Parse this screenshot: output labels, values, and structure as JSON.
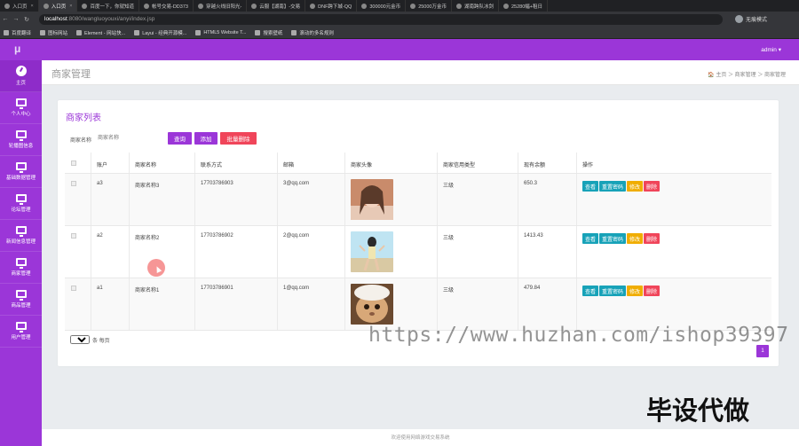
{
  "browser": {
    "tabs": [
      {
        "label": "入口页",
        "active": false
      },
      {
        "label": "入口页",
        "active": true
      },
      {
        "label": "百度一下，你就知道",
        "active": false
      },
      {
        "label": "帐号交易-DD373",
        "active": false
      },
      {
        "label": "穿越火线旧阳光-",
        "active": false
      },
      {
        "label": "云服【湖南】-交易",
        "active": false
      },
      {
        "label": "DNF跨下城-QQ",
        "active": false
      },
      {
        "label": "300000元金币",
        "active": false
      },
      {
        "label": "25000万金币",
        "active": false
      },
      {
        "label": "湖南跨队冰剑",
        "active": false
      },
      {
        "label": "25280幅+租日",
        "active": false
      }
    ],
    "url_host": "localhost",
    "url_path": ":8080/wangluoyouxi/anyi/index.jsp",
    "profile_label": "无痕模式",
    "bookmarks": [
      "百度翻译",
      "图标网站",
      "Element - 网站快...",
      "Layui - 经典开源模...",
      "HTML5 Website T...",
      "搜索壁纸",
      "滚动的多名规则"
    ]
  },
  "app": {
    "logo": "μ",
    "user": "admin ▾",
    "sidebar": [
      {
        "label": "主页",
        "icon": "dashboard-icon"
      },
      {
        "label": "个人中心",
        "icon": "monitor-icon"
      },
      {
        "label": "轮播图信息",
        "icon": "monitor-icon"
      },
      {
        "label": "基础数据管理",
        "icon": "monitor-icon"
      },
      {
        "label": "论坛管理",
        "icon": "monitor-icon"
      },
      {
        "label": "新闻信息管理",
        "icon": "monitor-icon"
      },
      {
        "label": "商家管理",
        "icon": "monitor-icon"
      },
      {
        "label": "商品管理",
        "icon": "monitor-icon"
      },
      {
        "label": "用户管理",
        "icon": "monitor-icon"
      }
    ],
    "page_title": "商家管理",
    "breadcrumb": "🏠 主页 ＞ 商家管理 ＞ 商家管理"
  },
  "list": {
    "title": "商家列表",
    "search_label": "商家名称",
    "search_placeholder": "商家名称",
    "buttons": {
      "query": "查询",
      "add": "添加",
      "batch_delete": "批量删除"
    },
    "columns": [
      "",
      "账户",
      "商家名称",
      "联系方式",
      "邮箱",
      "商家头像",
      "商家信用类型",
      "现有余额",
      "操作"
    ],
    "rows": [
      {
        "account": "a3",
        "name": "商家名称3",
        "phone": "17703786903",
        "email": "3@qq.com",
        "credit": "三级",
        "balance": "650.3"
      },
      {
        "account": "a2",
        "name": "商家名称2",
        "phone": "17703786902",
        "email": "2@qq.com",
        "credit": "三级",
        "balance": "1413.43"
      },
      {
        "account": "a1",
        "name": "商家名称1",
        "phone": "17703786901",
        "email": "1@qq.com",
        "credit": "三级",
        "balance": "479.84"
      }
    ],
    "actions": {
      "view": "查看",
      "reset": "重置密码",
      "edit": "修改",
      "delete": "删除"
    },
    "page_size": "10",
    "page_size_suffix": "条 每页",
    "current_page": "1"
  },
  "overlay": {
    "watermark": "https://www.huzhan.com/ishop39397",
    "stamp": "毕设代做"
  },
  "footer": "欢迎使用网络游戏交易系统"
}
